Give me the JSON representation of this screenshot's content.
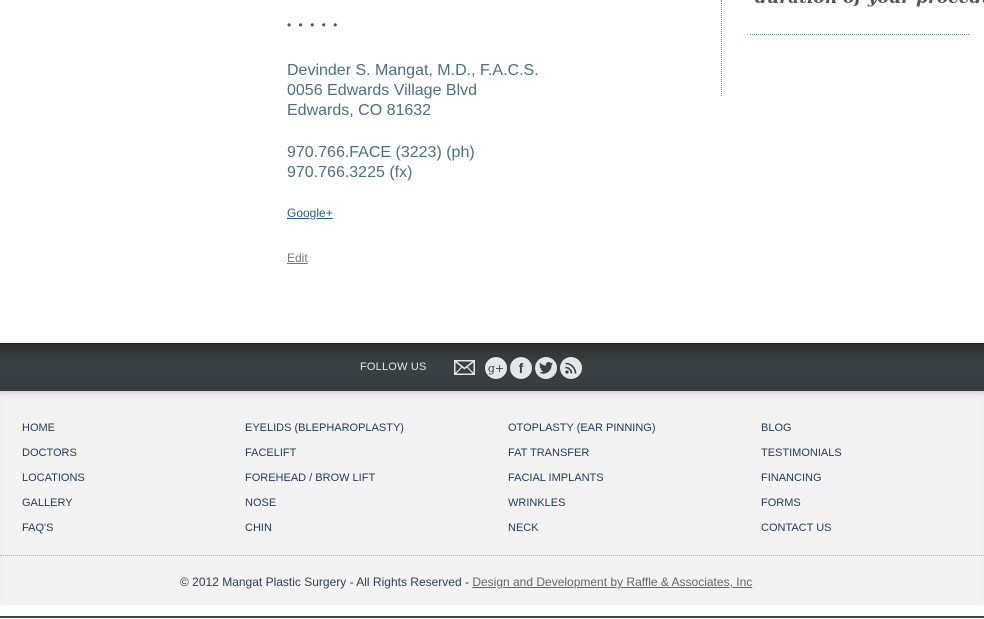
{
  "content": {
    "rating_dots": "• • • • •",
    "address_lines": [
      "Devinder S. Mangat, M.D., F.A.C.S.",
      "0056 Edwards Village Blvd",
      "Edwards, CO 81632"
    ],
    "phone": "970.766.FACE (3223) (ph)",
    "fax": "970.766.3225 (fx)",
    "google_link": "Google+",
    "edit_link": "Edit"
  },
  "sidebar": {
    "text": "duration of your procedure."
  },
  "follow": {
    "label": "FOLLOW US",
    "icons": [
      "mail-icon",
      "google-plus-icon",
      "facebook-icon",
      "twitter-icon",
      "rss-icon"
    ]
  },
  "footer_nav": {
    "col1": [
      "HOME",
      "DOCTORS",
      "LOCATIONS",
      "GALLERY",
      "FAQ'S"
    ],
    "col2": [
      "EYELIDS (BLEPHAROPLASTY)",
      "FACELIFT",
      "FOREHEAD / BROW LIFT",
      "NOSE",
      "CHIN"
    ],
    "col3": [
      "OTOPLASTY (EAR PINNING)",
      "FAT TRANSFER",
      "FACIAL IMPLANTS",
      "WRINKLES",
      "NECK"
    ],
    "col4": [
      "BLOG",
      "TESTIMONIALS",
      "FINANCING",
      "FORMS",
      "CONTACT US"
    ]
  },
  "copyright": {
    "text": "© 2012 Mangat Plastic Surgery - All Rights Reserved - ",
    "link": "Design and Development by Raffle & Associates, Inc"
  },
  "colors": {
    "follow_bar": "#373c3f",
    "link_blue": "#2a5d86",
    "address_text": "#4d6f85",
    "footer_bg": "#f3f3f3"
  }
}
